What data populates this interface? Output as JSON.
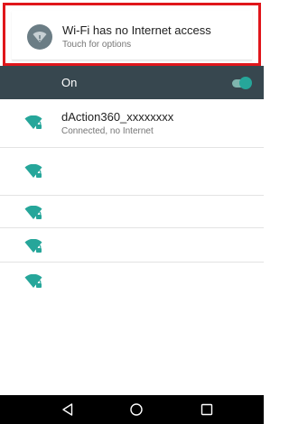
{
  "notification": {
    "icon": "wifi-alert-icon",
    "title": "Wi-Fi has no Internet access",
    "subtitle": "Touch for options",
    "highlight_color": "#e0161b"
  },
  "wifi_toggle": {
    "label": "On",
    "state": "on",
    "accent_color": "#26a69a",
    "bar_color": "#37474f"
  },
  "networks": [
    {
      "ssid": "dAction360_xxxxxxxx",
      "status": "Connected, no Internet",
      "icon": "wifi-locked-icon"
    },
    {
      "ssid": "",
      "status": "",
      "icon": "wifi-locked-icon"
    },
    {
      "ssid": "",
      "status": "",
      "icon": "wifi-locked-icon"
    },
    {
      "ssid": "",
      "status": "",
      "icon": "wifi-locked-icon"
    },
    {
      "ssid": "",
      "status": "",
      "icon": "wifi-locked-icon"
    }
  ],
  "navigation": {
    "back": "back-icon",
    "home": "home-icon",
    "recents": "recents-icon"
  }
}
